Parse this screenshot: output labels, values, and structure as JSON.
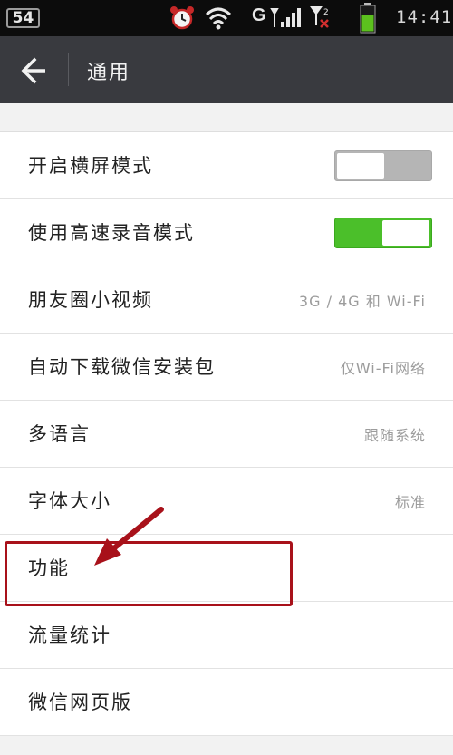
{
  "status_bar": {
    "battery_level": "54",
    "carrier_letter": "G",
    "time": "14:41",
    "icons": [
      "alarm-icon",
      "wifi-icon",
      "signal-icon",
      "signal-icon-2",
      "battery-icon"
    ]
  },
  "header": {
    "title": "通用",
    "back_icon": "back-arrow-icon"
  },
  "settings": [
    {
      "label": "开启横屏模式",
      "control": "toggle",
      "checked": false
    },
    {
      "label": "使用高速录音模式",
      "control": "toggle",
      "checked": true
    },
    {
      "label": "朋友圈小视频",
      "value": "3G / 4G 和 Wi-Fi"
    },
    {
      "label": "自动下载微信安装包",
      "value": "仅Wi-Fi网络"
    },
    {
      "label": "多语言",
      "value": "跟随系统"
    },
    {
      "label": "字体大小",
      "value": "标准"
    },
    {
      "label": "功能",
      "value": ""
    },
    {
      "label": "流量统计",
      "value": ""
    },
    {
      "label": "微信网页版",
      "value": ""
    }
  ],
  "colors": {
    "title_bar": "#393a3f",
    "toggle_on": "#4bbf2a",
    "annotation": "#a8111a"
  }
}
